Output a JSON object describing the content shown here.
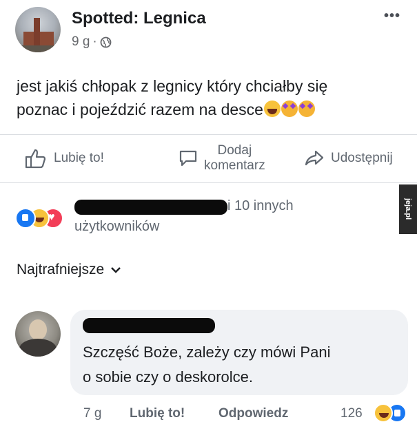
{
  "post": {
    "page_name": "Spotted: Legnica",
    "time": "9 g",
    "separator": "·",
    "text_line1": "jest jakiś chłopak z legnicy który chciałby się",
    "text_line2": "poznac i pojeździć razem na desce",
    "emojis": [
      "laughing-emoji",
      "star-struck-emoji",
      "star-struck-emoji"
    ]
  },
  "actions": {
    "like": "Lubię to!",
    "comment_line1": "Dodaj",
    "comment_line2": "komentarz",
    "share": "Udostępnij"
  },
  "reactions": {
    "others": "i 10 innych",
    "users": "użytkowników",
    "icons": [
      "like-reaction-icon",
      "haha-reaction-icon",
      "love-reaction-icon"
    ]
  },
  "side_tab": "jeja.pl",
  "sort": {
    "label": "Najtrafniejsze"
  },
  "comment": {
    "text_line1": "Szczęść Boże, zależy czy mówi Pani",
    "text_line2": "o sobie czy o deskorolce.",
    "time": "7 g",
    "like": "Lubię to!",
    "reply": "Odpowiedz",
    "reaction_count": "126"
  },
  "colors": {
    "facebook_blue": "#1877f2",
    "text_primary": "#1c1e21",
    "text_secondary": "#606770",
    "bubble_bg": "#f0f2f5"
  }
}
